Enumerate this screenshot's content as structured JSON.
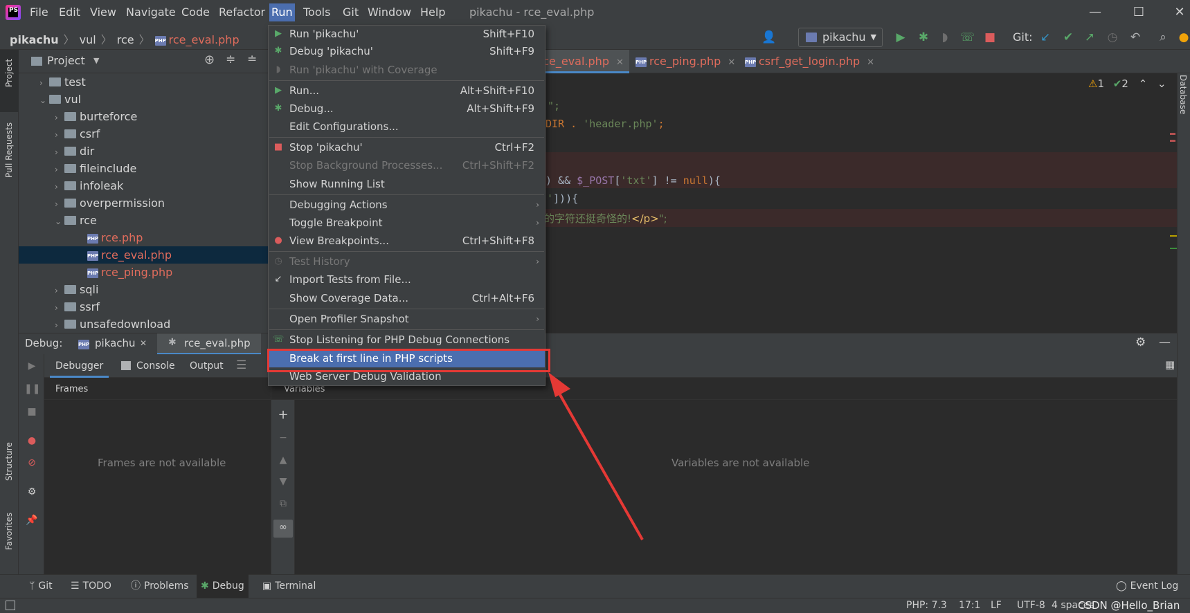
{
  "menubar": {
    "logo_text": "PS",
    "items": [
      "File",
      "Edit",
      "View",
      "Navigate",
      "Code",
      "Refactor",
      "Run",
      "Tools",
      "Git",
      "Window",
      "Help"
    ],
    "active_item": "Run",
    "window_title": "pikachu - rce_eval.php"
  },
  "navbar": {
    "breadcrumb": [
      "pikachu",
      "vul",
      "rce",
      "rce_eval.php"
    ],
    "run_config": "pikachu",
    "git_label": "Git:"
  },
  "left_stripe": {
    "labels": [
      "Project",
      "Pull Requests",
      "Structure",
      "Favorites"
    ]
  },
  "right_stripe": {
    "label": "Database"
  },
  "project_panel": {
    "title": "Project",
    "tree": [
      {
        "label": "test",
        "type": "folder",
        "expanded": false
      },
      {
        "label": "vul",
        "type": "folder",
        "expanded": true
      },
      {
        "label": "burteforce",
        "type": "folder",
        "expanded": false
      },
      {
        "label": "csrf",
        "type": "folder",
        "expanded": false
      },
      {
        "label": "dir",
        "type": "folder",
        "expanded": false
      },
      {
        "label": "fileinclude",
        "type": "folder",
        "expanded": false
      },
      {
        "label": "infoleak",
        "type": "folder",
        "expanded": false
      },
      {
        "label": "overpermission",
        "type": "folder",
        "expanded": false
      },
      {
        "label": "rce",
        "type": "folder",
        "expanded": true
      },
      {
        "label": "rce.php",
        "type": "php"
      },
      {
        "label": "rce_eval.php",
        "type": "php",
        "selected": true
      },
      {
        "label": "rce_ping.php",
        "type": "php"
      },
      {
        "label": "sqli",
        "type": "folder",
        "expanded": false
      },
      {
        "label": "ssrf",
        "type": "folder",
        "expanded": false
      },
      {
        "label": "unsafedownload",
        "type": "folder",
        "expanded": false
      }
    ]
  },
  "editor": {
    "tabs": [
      "rce_eval.php",
      "rce_ping.php",
      "csrf_get_login.php"
    ],
    "active_tab": "rce_eval.php",
    "inspection": {
      "warnings": "1",
      "ok": "2"
    },
    "code_fragments": {
      "l1": "\";",
      "l2_a": "DIR . ",
      "l2_b": "'header.php'",
      "l2_c": ";",
      "l4_a": ") && ",
      "l4_b": "$_POST",
      "l4_c": "[",
      "l4_d": "'txt'",
      "l4_e": "] != ",
      "l4_f": "null",
      "l4_g": "){",
      "l5_a": "'",
      "l5_b": "])){",
      "l6_a": "的字符还挺奇怪的!",
      "l6_b": "</p>",
      "l6_c": "\";"
    }
  },
  "run_menu": {
    "items": [
      {
        "label": "Run 'pikachu'",
        "shortcut": "Shift+F10",
        "icon": "run-icon"
      },
      {
        "label": "Debug 'pikachu'",
        "shortcut": "Shift+F9",
        "icon": "debug-icon"
      },
      {
        "label": "Run 'pikachu' with Coverage",
        "shortcut": "",
        "icon": "coverage-icon",
        "disabled": true
      },
      {
        "label": "Run...",
        "shortcut": "Alt+Shift+F10",
        "icon": "run-icon"
      },
      {
        "label": "Debug...",
        "shortcut": "Alt+Shift+F9",
        "icon": "debug-icon"
      },
      {
        "label": "Edit Configurations...",
        "shortcut": ""
      },
      {
        "label": "Stop 'pikachu'",
        "shortcut": "Ctrl+F2",
        "icon": "stop-icon"
      },
      {
        "label": "Stop Background Processes...",
        "shortcut": "Ctrl+Shift+F2",
        "disabled": true
      },
      {
        "label": "Show Running List",
        "shortcut": ""
      },
      {
        "label": "Debugging Actions",
        "shortcut": "",
        "submenu": true
      },
      {
        "label": "Toggle Breakpoint",
        "shortcut": "",
        "submenu": true
      },
      {
        "label": "View Breakpoints...",
        "shortcut": "Ctrl+Shift+F8",
        "icon": "breakpoints-icon"
      },
      {
        "label": "Test History",
        "shortcut": "",
        "submenu": true,
        "disabled": true
      },
      {
        "label": "Import Tests from File...",
        "shortcut": "",
        "icon": "import-icon"
      },
      {
        "label": "Show Coverage Data...",
        "shortcut": "Ctrl+Alt+F6"
      },
      {
        "label": "Open Profiler Snapshot",
        "shortcut": "",
        "submenu": true
      },
      {
        "label": "Stop Listening for PHP Debug Connections",
        "shortcut": "",
        "icon": "listen-icon"
      },
      {
        "label": "Break at first line in PHP scripts",
        "shortcut": "",
        "highlighted": true
      },
      {
        "label": "Web Server Debug Validation",
        "shortcut": ""
      }
    ]
  },
  "debug_panel": {
    "title": "Debug:",
    "sessions": [
      "pikachu",
      "rce_eval.php"
    ],
    "tabs": [
      "Debugger",
      "Console",
      "Output"
    ],
    "frames_header": "Frames",
    "frames_empty": "Frames are not available",
    "variables_header": "Variables",
    "variables_empty": "Variables are not available"
  },
  "bottom_bar": {
    "tabs": [
      "Git",
      "TODO",
      "Problems",
      "Debug",
      "Terminal"
    ],
    "active_tab": "Debug",
    "event_log": "Event Log"
  },
  "status_bar": {
    "php_version": "PHP: 7.3",
    "position": "17:1",
    "line_sep": "LF",
    "encoding": "UTF-8",
    "indent": "4 spaces",
    "watermark": "CSDN @Hello_Brian"
  },
  "colors": {
    "accent": "#4b6eaf",
    "annotation_red": "#e53935",
    "modified_file": "#e06c5c"
  }
}
